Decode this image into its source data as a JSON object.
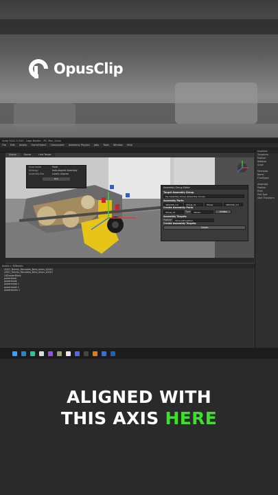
{
  "brand": {
    "name": "OpusClip",
    "icon": "opusclip-logo"
  },
  "editor": {
    "title": "Unity 2022.3.21f1 - Lego Builder - PC, Mac, Linux",
    "menu": [
      "File",
      "Edit",
      "Assets",
      "GameObject",
      "Component",
      "Assembly Physics",
      "Jobs",
      "Tools",
      "Window",
      "Help"
    ],
    "tabs": [
      "Scene",
      "Game",
      "Unit Tester"
    ],
    "gizmo_popup": {
      "rows": [
        {
          "key": "Snap mode",
          "value": "Pivot"
        },
        {
          "key": "Strategy",
          "value": "Auto aligned Assembly"
        },
        {
          "key": "Assembly Box",
          "value": "Locally aligned"
        }
      ],
      "button": "Run"
    },
    "panel": {
      "title": "Assembly Group Editor",
      "target_heading": "Target Assembly Group",
      "target_value": "My Assembly Group (Assembly Group)",
      "parts_heading": "Assembly Parts",
      "part_row": {
        "id": "4NSCDB_4.6",
        "name": "Wheel_01",
        "type": "Wheel",
        "extra": "4NSCDB_4.6"
      },
      "create_parts_heading": "Create Assembly Parts",
      "create_row": {
        "id": "Wheel_01",
        "type_label": "Type",
        "type": "Wheel",
        "button": "Create"
      },
      "targets_heading": "Assembly Targets",
      "target_field_label": "Position",
      "target_field_value": "None (Moveable)",
      "create_targets_heading": "Create Assembly Targets",
      "create_button": "Create"
    },
    "scene_bar": {
      "label": "Scene Helper"
    },
    "inspector": {
      "title": "Inspector",
      "lines": [
        "Transform",
        "Position",
        "Rotation",
        "Scale",
        "Mercedes",
        "Name",
        "FluidTypes",
        "Assembly",
        "Position",
        "Parts",
        "Part Type",
        "Start Transform"
      ]
    },
    "project": {
      "path": "Assets > 3DModels",
      "items": [
        "LEGO_Technic_Mercedes_Benz_Arocs_42043",
        "LEGO_Technic_Mercedes_Benz_Arocs_42043",
        "LDDrawerBlock",
        "powerblock",
        "powerblade",
        "powermode 1",
        "powermode 1",
        "powerblocks 1"
      ]
    }
  },
  "taskbar": {
    "icons": [
      "windows-icon",
      "vscode-icon",
      "edge-icon",
      "unity-icon",
      "vs-icon",
      "gimp-icon",
      "github-icon",
      "discord-icon",
      "terminal-icon",
      "blender-icon",
      "store-icon",
      "outlook-icon"
    ]
  },
  "caption": {
    "line1": "ALIGNED WITH",
    "line2_before": "THIS AXIS ",
    "line2_highlight": "HERE"
  },
  "colors": {
    "highlight": "#3be12b",
    "caption_text": "#ffffff"
  }
}
